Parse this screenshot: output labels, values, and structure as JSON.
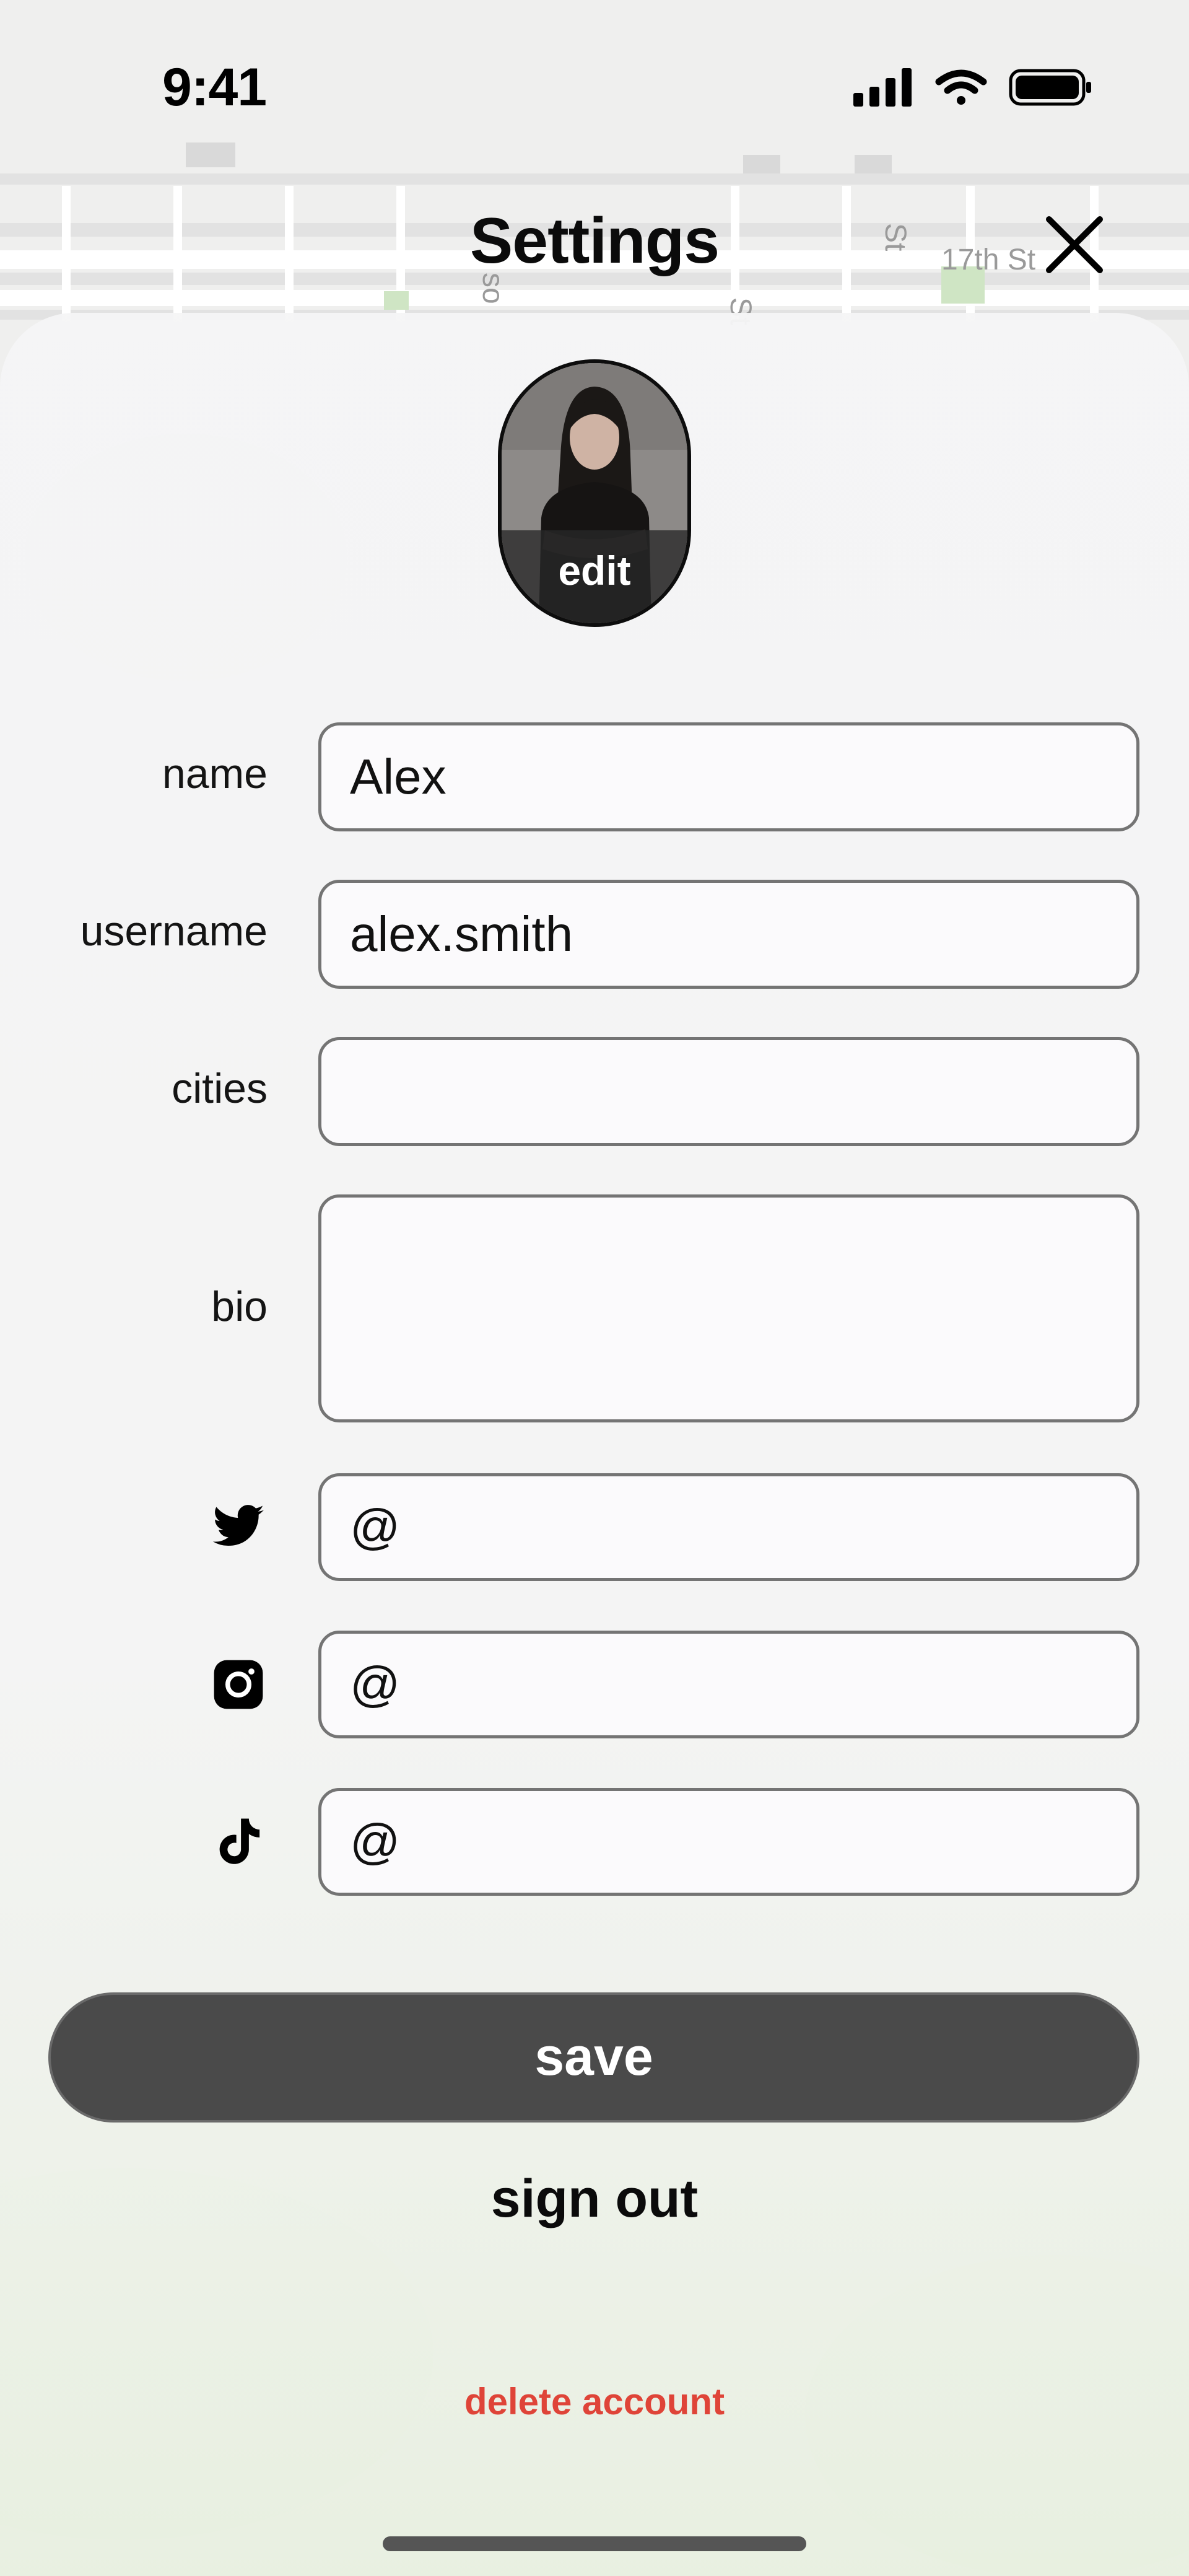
{
  "status_bar": {
    "time": "9:41",
    "icons": [
      "cellular-signal-icon",
      "wifi-icon",
      "battery-icon"
    ]
  },
  "map": {
    "street_labels": [
      "17th St",
      "St",
      "so",
      "St"
    ]
  },
  "header": {
    "title": "Settings",
    "close_icon": "close-icon"
  },
  "avatar": {
    "edit_label": "edit"
  },
  "form": {
    "name_label": "name",
    "name_value": "Alex",
    "username_label": "username",
    "username_value": "alex.smith",
    "cities_label": "cities",
    "cities_value": "",
    "bio_label": "bio",
    "bio_value": "",
    "twitter_icon": "twitter-icon",
    "twitter_value": "@",
    "instagram_icon": "instagram-icon",
    "instagram_value": "@",
    "tiktok_icon": "tiktok-icon",
    "tiktok_value": "@"
  },
  "actions": {
    "save_label": "save",
    "sign_out_label": "sign out",
    "delete_label": "delete account"
  },
  "colors": {
    "save_button": "#4a4a4a",
    "danger": "#df4438",
    "text": "#0b0b0b"
  }
}
